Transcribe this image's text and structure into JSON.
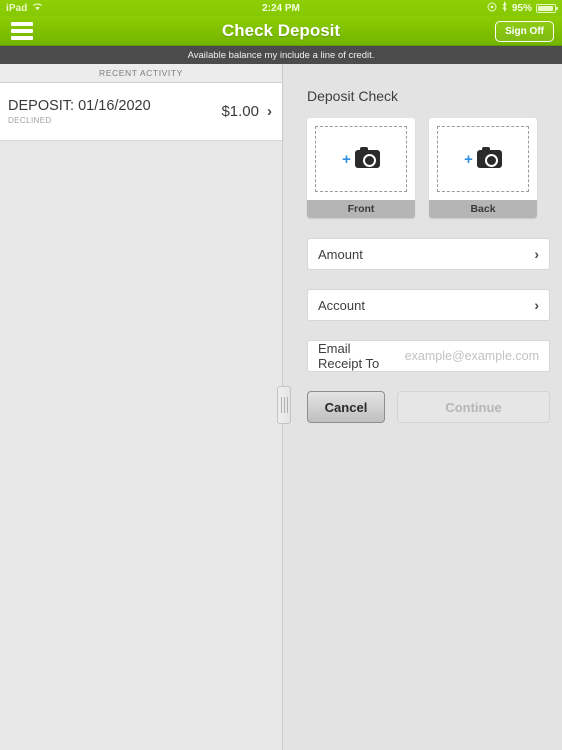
{
  "status_bar": {
    "device": "iPad",
    "wifi_icon": "wifi-icon",
    "time": "2:24 PM",
    "rotation_lock_icon": "rotation-lock-icon",
    "bluetooth_icon": "bluetooth-icon",
    "battery_percent": "95%"
  },
  "navbar": {
    "menu_icon": "hamburger-menu-icon",
    "title": "Check Deposit",
    "sign_off_label": "Sign Off"
  },
  "notice": {
    "text": "Available balance my include a line of credit."
  },
  "left_pane": {
    "header": "RECENT ACTIVITY",
    "rows": [
      {
        "title": "DEPOSIT:  01/16/2020",
        "status": "DECLINED",
        "amount": "$1.00",
        "chevron": "chevron-right-icon"
      }
    ]
  },
  "divider": {
    "handle_icon": "split-view-drag-handle"
  },
  "right_pane": {
    "section_title": "Deposit Check",
    "captures": [
      {
        "label": "Front",
        "plus": "+",
        "camera_icon": "camera-icon"
      },
      {
        "label": "Back",
        "plus": "+",
        "camera_icon": "camera-icon"
      }
    ],
    "fields": [
      {
        "label": "Amount",
        "chevron": "chevron-right-icon"
      },
      {
        "label": "Account",
        "chevron": "chevron-right-icon"
      }
    ],
    "email_field": {
      "label": "Email Receipt To",
      "placeholder": "example@example.com",
      "value": ""
    },
    "buttons": {
      "cancel": "Cancel",
      "continue": "Continue"
    }
  },
  "colors": {
    "brand_green": "#86c904",
    "notice_bar": "#4b4b4b",
    "accent_blue": "#2f8fe0",
    "pane_background": "#e3e3e3"
  }
}
